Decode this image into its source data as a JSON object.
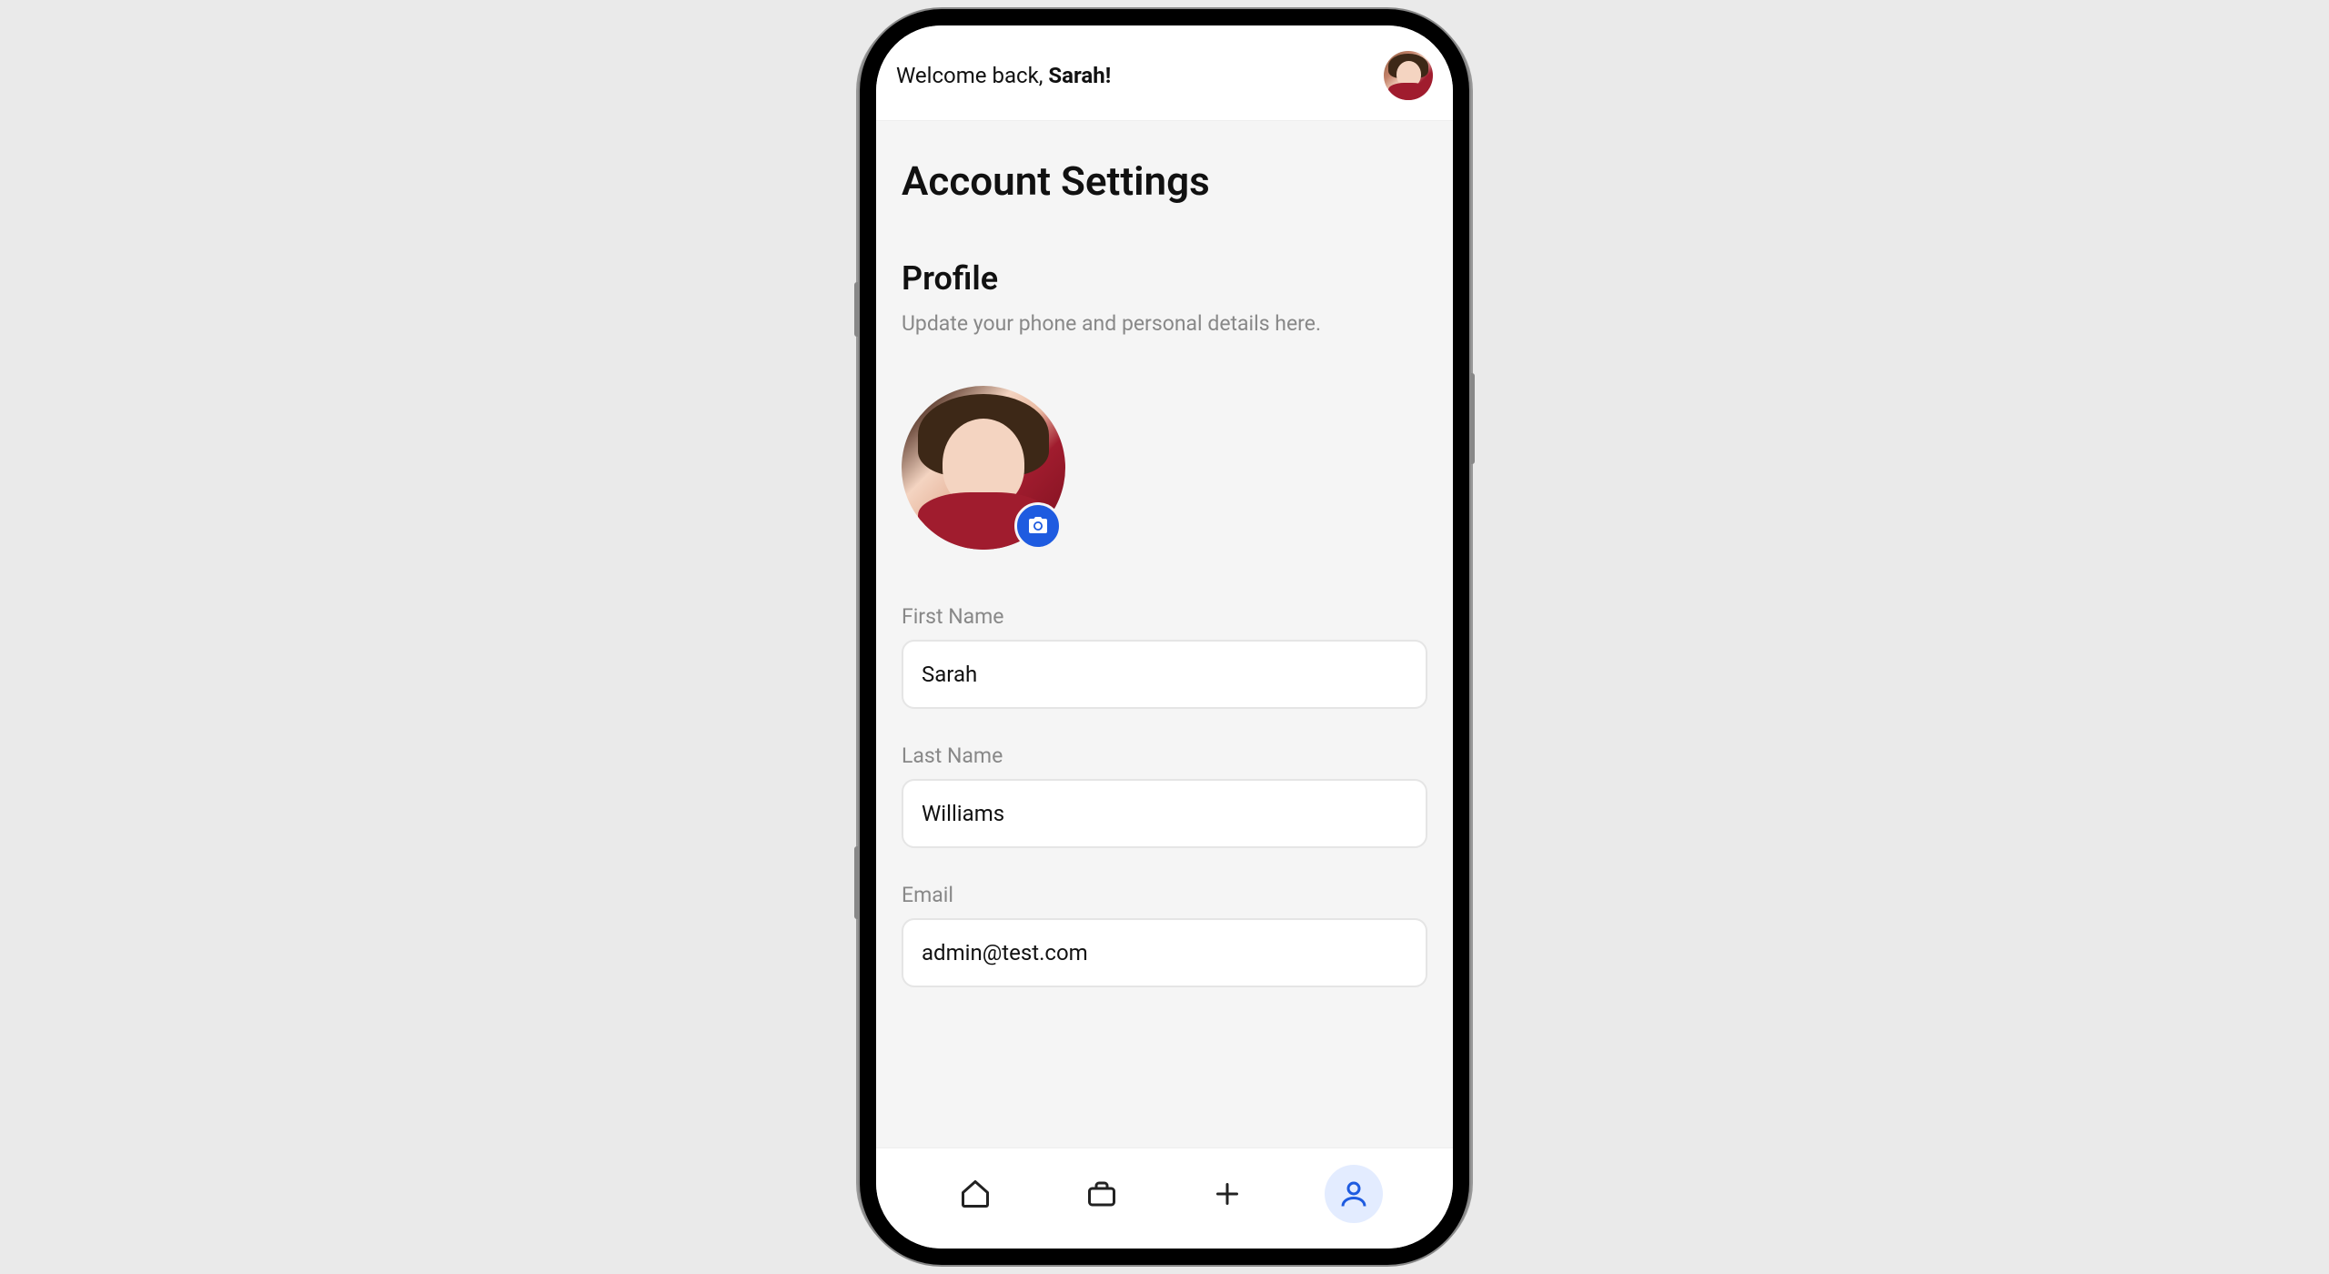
{
  "header": {
    "welcome_prefix": "Welcome back, ",
    "user_name": "Sarah!"
  },
  "page": {
    "title": "Account Settings",
    "section_title": "Profile",
    "section_desc": "Update your phone and personal details here."
  },
  "fields": {
    "first_name": {
      "label": "First Name",
      "value": "Sarah"
    },
    "last_name": {
      "label": "Last Name",
      "value": "Williams"
    },
    "email": {
      "label": "Email",
      "value": "admin@test.com"
    }
  },
  "icons": {
    "camera": "camera-icon",
    "home": "home-icon",
    "briefcase": "briefcase-icon",
    "plus": "plus-icon",
    "profile": "profile-icon"
  },
  "colors": {
    "accent": "#1e5be0",
    "background": "#f5f5f5",
    "text_muted": "#888",
    "border": "#e5e5e5"
  }
}
